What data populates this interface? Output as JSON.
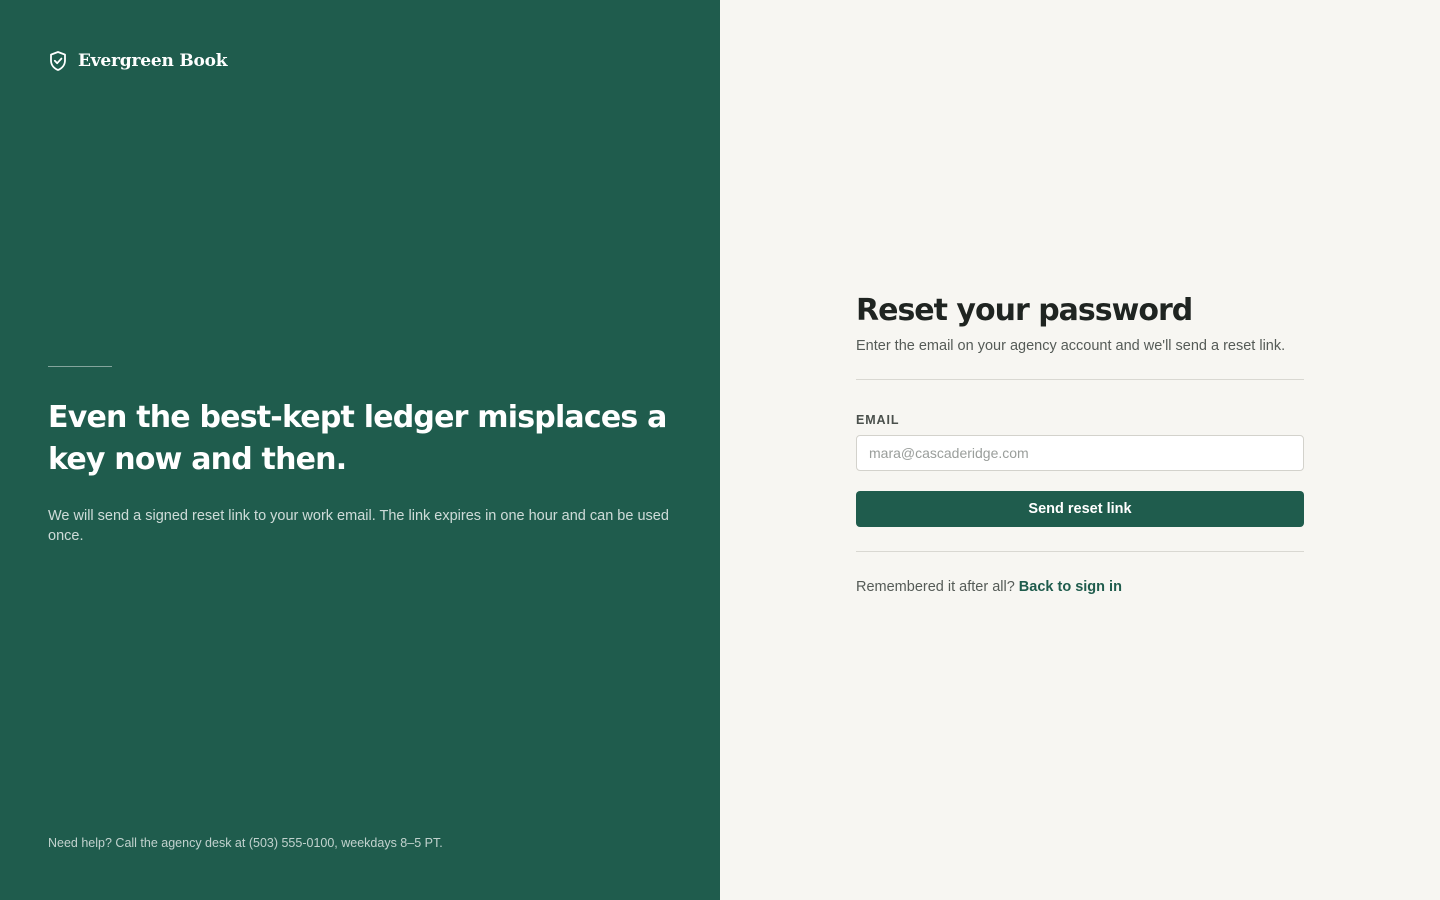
{
  "brand": {
    "name": "Evergreen Book",
    "icon": "shield-check-icon"
  },
  "hero": {
    "title": "Even the best-kept ledger misplaces a key now and then.",
    "body": "We will send a signed reset link to your work email. The link expires in one hour and can be used once."
  },
  "help": {
    "text": "Need help? Call the agency desk at (503) 555-0100, weekdays 8–5 PT."
  },
  "form": {
    "title": "Reset your password",
    "subtitle": "Enter the email on your agency account and we'll send a reset link.",
    "email_label": "EMAIL",
    "email_value": "",
    "email_placeholder": "mara@cascaderidge.com",
    "submit_label": "Send reset link",
    "back_prompt": "Remembered it after all?",
    "back_link": "Back to sign in"
  },
  "colors": {
    "brand_green": "#1f5c4d",
    "panel_background": "#f7f6f2",
    "text_dark": "#1f2421"
  }
}
